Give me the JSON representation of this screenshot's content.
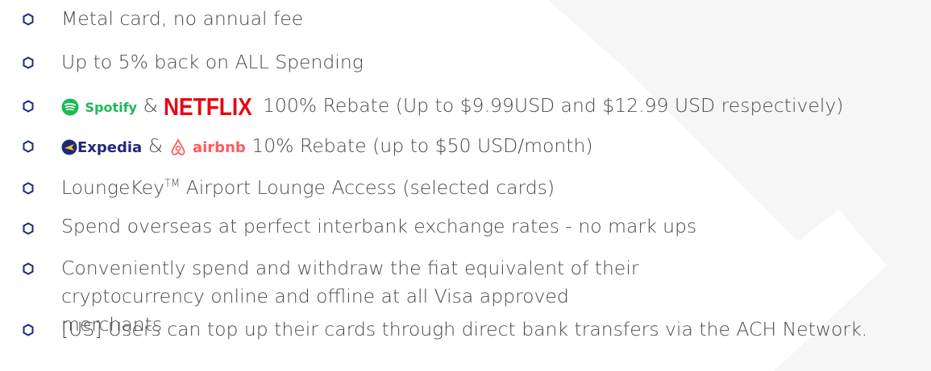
{
  "colors": {
    "bullet": "#1E2A78",
    "text": "#4a4a4a",
    "spotify": "#1DB954",
    "netflix": "#E50914",
    "expedia": "#1E2A78",
    "expedia_accent": "#FFC72C",
    "airbnb": "#FF5A5F",
    "background_shape": "#f7f7f8"
  },
  "features": {
    "item1": "Metal card, no annual fee",
    "item2": "Up to 5% back on ALL Spending",
    "item3": {
      "spotify_logo": "Spotify",
      "amp": "&",
      "netflix_logo": "NETFLIX",
      "text": "100% Rebate (Up to $9.99USD and $12.99 USD respectively)"
    },
    "item4": {
      "expedia_logo": "Expedia",
      "amp": "&",
      "airbnb_logo": "airbnb",
      "text": "10% Rebate (up to $50 USD/month)"
    },
    "item5": {
      "text_before": "LoungeKey",
      "tm": "TM",
      "text_after": " Airport Lounge Access (selected cards)"
    },
    "item6": "Spend overseas at perfect interbank exchange rates - no mark ups",
    "item7": "Conveniently spend and withdraw the fiat equivalent of their cryptocurrency online and offline at all Visa approved merchants",
    "item8": "[US] Users can top up their cards through direct bank transfers via the ACH Network."
  }
}
